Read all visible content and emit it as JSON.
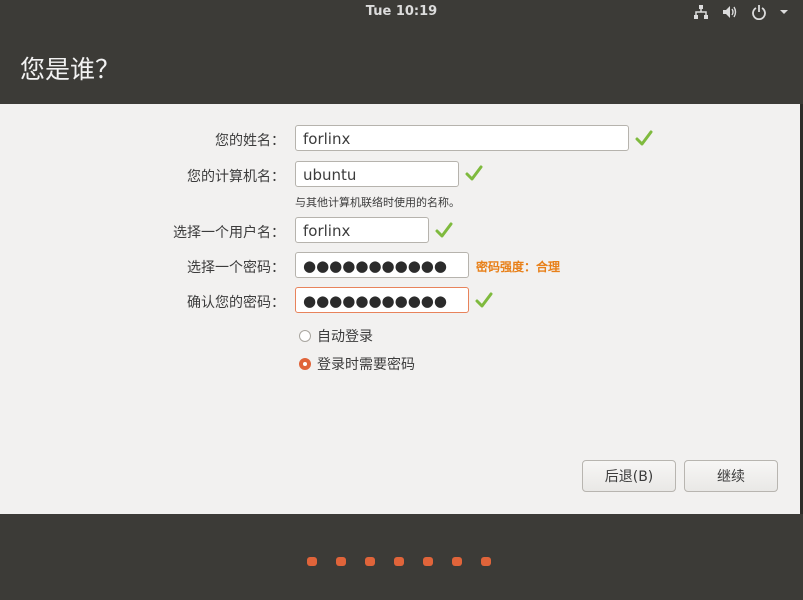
{
  "topbar": {
    "clock": "Tue 10:19",
    "icons": [
      "network-icon",
      "volume-icon",
      "power-icon",
      "chevron-down-icon"
    ]
  },
  "page": {
    "title": "您是谁？"
  },
  "form": {
    "name_label": "您的姓名：",
    "name_value": "forlinx",
    "computer_label": "您的计算机名：",
    "computer_value": "ubuntu",
    "computer_hint": "与其他计算机联络时使用的名称。",
    "username_label": "选择一个用户名：",
    "username_value": "forlinx",
    "password_label": "选择一个密码：",
    "password_value": "●●●●●●●●●●●",
    "password_strength": "密码强度：合理",
    "confirm_label": "确认您的密码：",
    "confirm_value": "●●●●●●●●●●●"
  },
  "login": {
    "auto_login": "自动登录",
    "require_password": "登录时需要密码",
    "selected": "require_password"
  },
  "buttons": {
    "back": "后退(B)",
    "continue": "继续"
  },
  "progress": {
    "steps": 7
  },
  "colors": {
    "accent": "#e0643a",
    "check": "#7fba3e",
    "strength": "#e88019",
    "panel": "#3c3b37"
  }
}
